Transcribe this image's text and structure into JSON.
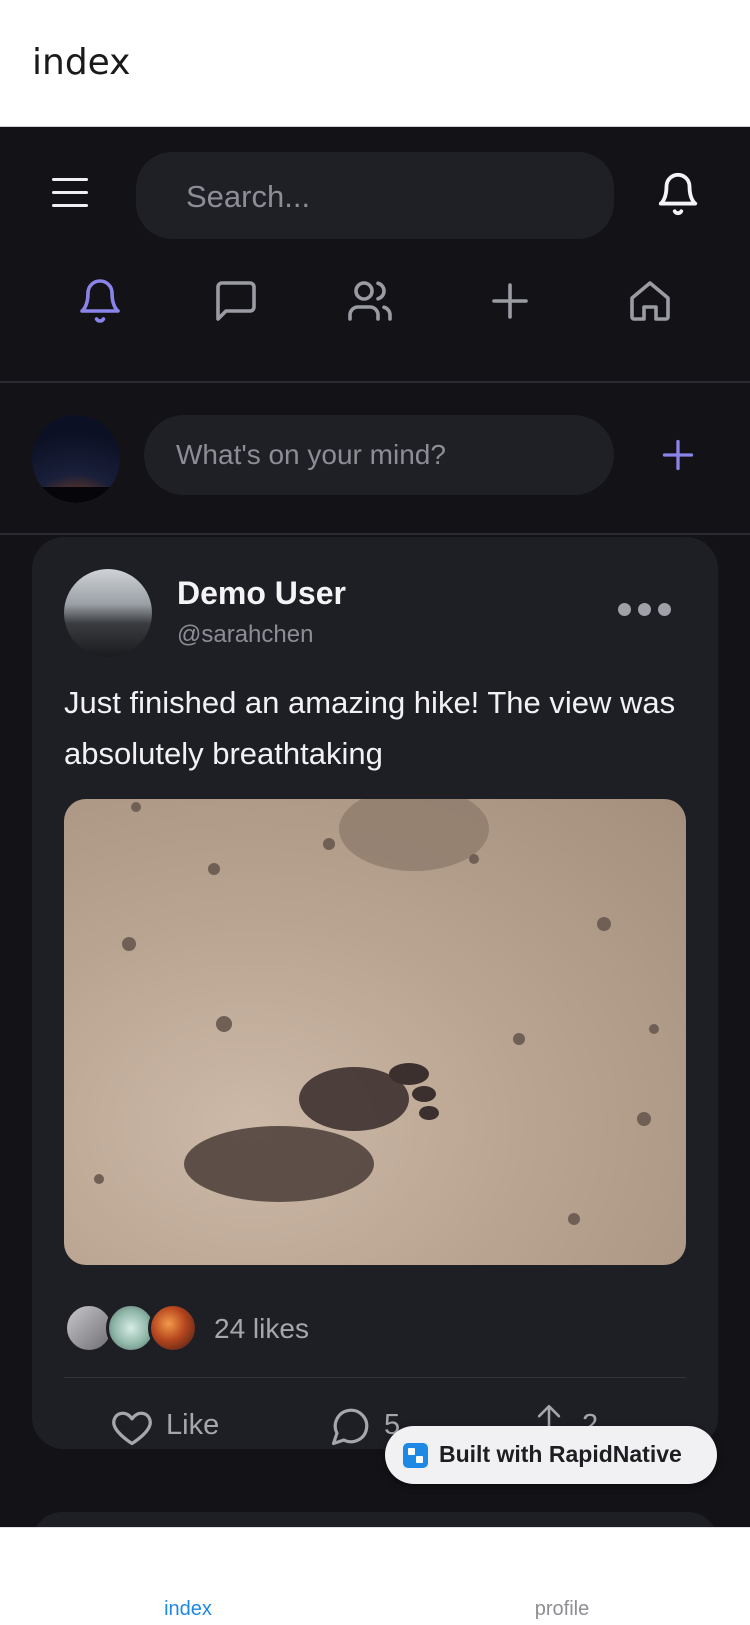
{
  "window": {
    "title": "index"
  },
  "header": {
    "menu_icon": "hamburger-menu-icon",
    "search_placeholder": "Search...",
    "bell_icon": "bell-icon"
  },
  "nav_icons": [
    {
      "icon": "bell-icon",
      "active": true
    },
    {
      "icon": "chat-icon",
      "active": false
    },
    {
      "icon": "users-icon",
      "active": false
    },
    {
      "icon": "plus-icon",
      "active": false
    },
    {
      "icon": "home-icon",
      "active": false
    }
  ],
  "composer": {
    "placeholder": "What's on your mind?",
    "add_icon": "plus-icon"
  },
  "post": {
    "author_name": "Demo User",
    "author_handle": "@sarahchen",
    "text": "Just finished an amazing hike! The view was absolutely breathtaking",
    "likes_label": "24 likes",
    "actions": {
      "like_label": "Like",
      "comment_count": "5",
      "share_count": "2"
    }
  },
  "badge": {
    "label": "Built with RapidNative"
  },
  "tabs": [
    {
      "label": "index",
      "active": true
    },
    {
      "label": "profile",
      "active": false
    }
  ],
  "colors": {
    "background": "#121217",
    "card": "#1e1f25",
    "accent": "#8b84e8",
    "tab_active": "#1e88e5",
    "tab_inactive": "#8e8e93"
  }
}
